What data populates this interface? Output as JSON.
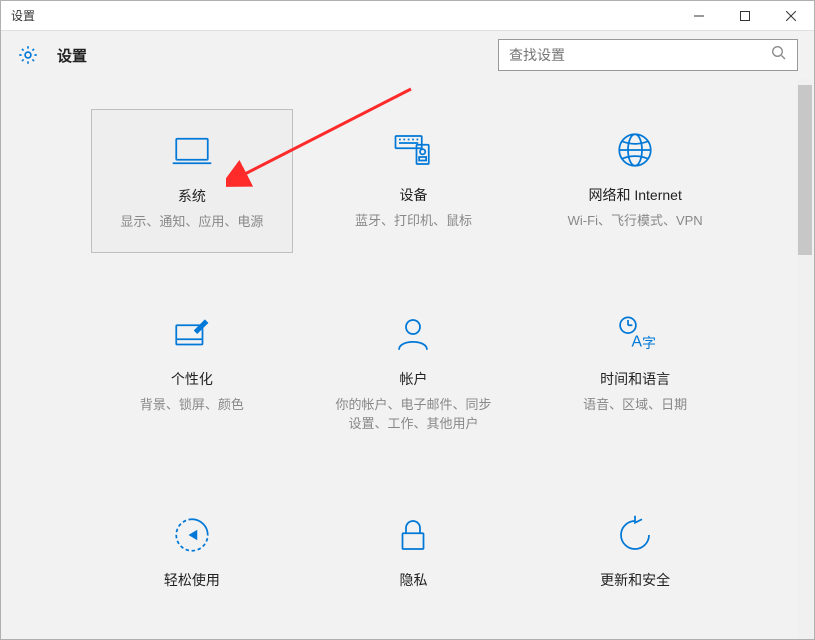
{
  "window": {
    "title": "设置"
  },
  "header": {
    "title": "设置"
  },
  "search": {
    "placeholder": "查找设置"
  },
  "tiles": [
    {
      "title": "系统",
      "desc": "显示、通知、应用、电源",
      "highlight": true
    },
    {
      "title": "设备",
      "desc": "蓝牙、打印机、鼠标"
    },
    {
      "title": "网络和 Internet",
      "desc": "Wi-Fi、飞行模式、VPN"
    },
    {
      "title": "个性化",
      "desc": "背景、锁屏、颜色"
    },
    {
      "title": "帐户",
      "desc": "你的帐户、电子邮件、同步设置、工作、其他用户"
    },
    {
      "title": "时间和语言",
      "desc": "语音、区域、日期"
    },
    {
      "title": "轻松使用",
      "desc": ""
    },
    {
      "title": "隐私",
      "desc": ""
    },
    {
      "title": "更新和安全",
      "desc": ""
    }
  ]
}
